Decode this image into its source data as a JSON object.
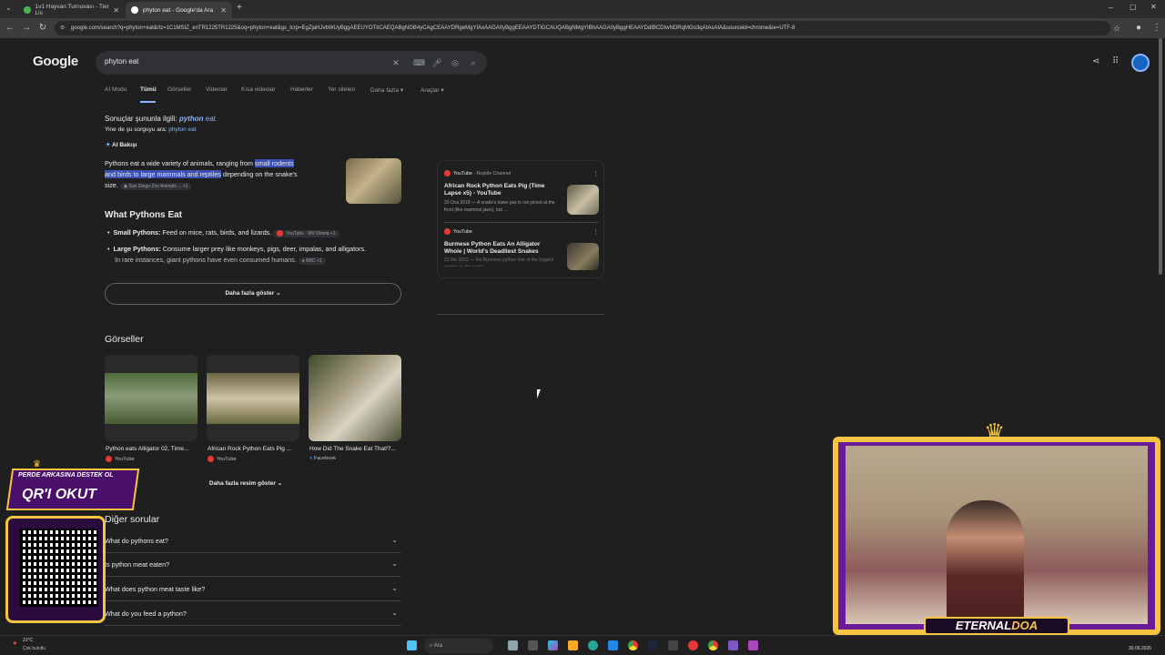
{
  "browser": {
    "tabs": [
      {
        "title": "1v1 Hayvan Turnuvası - Tier Lis"
      },
      {
        "title": "phyton eat - Google'da Ara"
      }
    ],
    "url": "google.com/search?q=phyton+eat&rlz=1C1MSIZ_enTR1225TR1225&oq=phyton+eat&gs_lcrp=EgZjaHJvbWUyBggAEEUYOTIICAEQABgNGB4yCAgCEAAYDRgeMgYIAxAAGA0yBggEEAAYDTIGCAUQABgNMgYIBhAAGA0yBggHEAAYDdIBCDIwNDRqMGo3qAIAsAIA&sourceid=chrome&ie=UTF-8"
  },
  "google": {
    "logo": "Google",
    "query": "phyton eat",
    "tabs": [
      "AI Modu",
      "Tümü",
      "Görseller",
      "Videolar",
      "Kısa videolar",
      "Haberler",
      "Yer siteleri",
      "Daha fazla",
      "Araçlar"
    ],
    "results_for_prefix": "Sonuçlar şununla ilgili:",
    "results_for_bold": "python",
    "results_for_rest": " eat",
    "search_instead_prefix": "Yine de şu sorguyu ara:",
    "search_instead_link": "phyton eat",
    "ai_overview_label": "AI Bakışı",
    "ai_text_1": "Pythons eat a wide variety of animals, ranging from ",
    "ai_text_hl_1": "small rodents",
    "ai_text_hl_2": "and birds to large mammals and reptiles",
    "ai_text_2": " depending on the snake's",
    "ai_text_3": "size.",
    "ai_source": "San Diego Zoo Animals ...",
    "ai_source_more": "+1",
    "what_title": "What Pythons Eat",
    "bullet1_bold": "Small Pythons:",
    "bullet1_text": " Feed on mice, rats, birds, and lizards.",
    "bullet1_src": "YouTube · MV Dinma +1",
    "bullet2_bold": "Large Pythons:",
    "bullet2_text": " Consume larger prey like monkeys, pigs, deer, impalas, and alligators.",
    "bullet2_text2": "In rare instances, giant pythons have even consumed humans.",
    "bullet2_src": "BBC +1",
    "show_more": "Daha fazla göster",
    "videos": [
      {
        "source": "YouTube",
        "channel": "· Reptile Channel",
        "title": "African Rock Python Eats Pig (Time Lapse x5) - YouTube",
        "snippet": "20 Oca 2018 — A snake's lower jaw is not joined at the front (like mammal jaws), but ..."
      },
      {
        "source": "YouTube",
        "channel": "",
        "title": "Burmese Python Eats An Alligator Whole | World's Deadliest Snakes",
        "snippet": "23 Nis 2023 — the Burmese python one of the biggest snakes in the world ..."
      }
    ],
    "images_title": "Görseller",
    "images": [
      {
        "caption": "Python eats Alligator 02, Time...",
        "source": "YouTube"
      },
      {
        "caption": "African Rock Python Eats Pig ...",
        "source": "YouTube"
      },
      {
        "caption": "How Did The Snake Eat That!?...",
        "source": "Facebook"
      }
    ],
    "more_images": "Daha fazla resim göster",
    "paa_title": "Diğer sorular",
    "paa": [
      "What do pythons eat?",
      "Is python meat eaten?",
      "What does python meat taste like?",
      "What do you feed a python?"
    ]
  },
  "overlay": {
    "qr_line1": "PERDE ARKASINA DESTEK OL",
    "qr_line2": "QR'I OKUT",
    "webcam_name_1": "ETERNAL",
    "webcam_name_2": "DOA"
  },
  "taskbar": {
    "weather_temp": "21°C",
    "weather_desc": "Çok bulutlu",
    "search_label": "Ara",
    "time": "",
    "date": "30.06.2026"
  },
  "colors": {
    "accent": "#8ab4f8",
    "highlight": "#3c4fb3",
    "page_bg": "#1f1f1f",
    "overlay_purple": "#6a1b9a",
    "overlay_gold": "#f5c542"
  }
}
